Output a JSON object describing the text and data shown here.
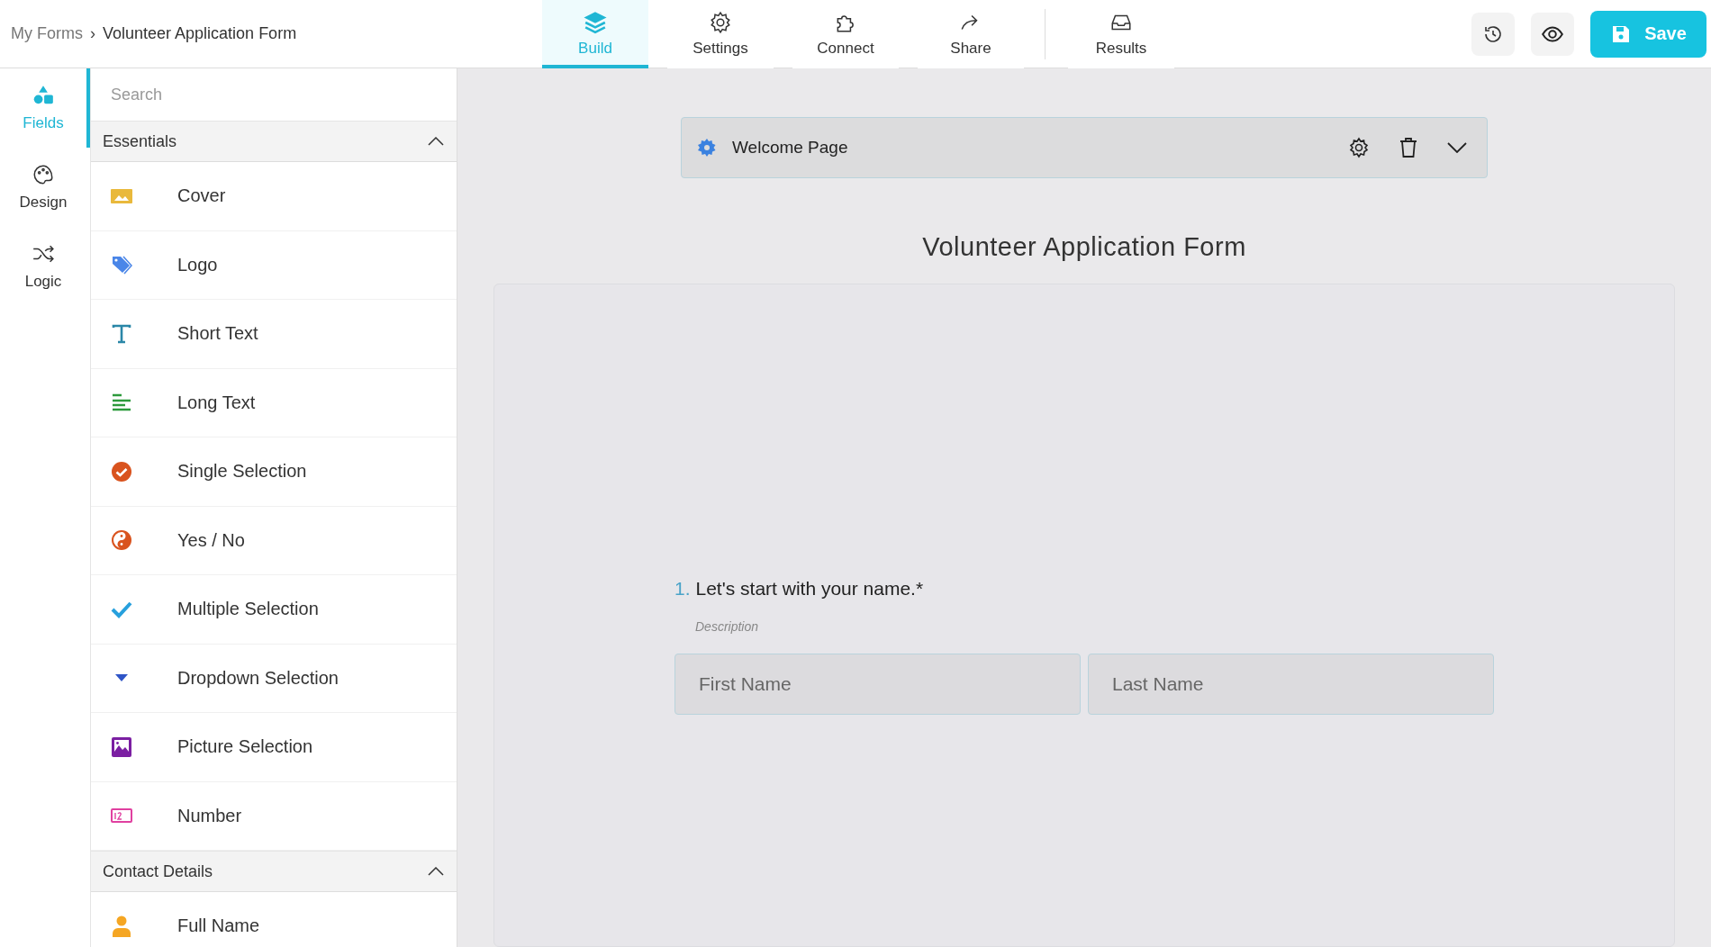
{
  "breadcrumb": {
    "parent": "My Forms",
    "separator": "›",
    "current": "Volunteer Application Form"
  },
  "tabs": [
    {
      "label": "Build",
      "kind": "build",
      "selected": true
    },
    {
      "label": "Settings",
      "kind": "settings",
      "selected": false
    },
    {
      "label": "Connect",
      "kind": "connect",
      "selected": false
    },
    {
      "label": "Share",
      "kind": "share",
      "selected": false
    },
    {
      "label": "Results",
      "kind": "results",
      "selected": false
    }
  ],
  "save_button": {
    "label": "Save"
  },
  "rail": [
    {
      "label": "Fields",
      "kind": "fields",
      "selected": true
    },
    {
      "label": "Design",
      "kind": "design",
      "selected": false
    },
    {
      "label": "Logic",
      "kind": "logic",
      "selected": false
    }
  ],
  "search": {
    "placeholder": "Search"
  },
  "sections": [
    {
      "title": "Essentials",
      "expanded": true,
      "items": [
        {
          "label": "Cover",
          "kind": "cover"
        },
        {
          "label": "Logo",
          "kind": "logo"
        },
        {
          "label": "Short Text",
          "kind": "short"
        },
        {
          "label": "Long Text",
          "kind": "long"
        },
        {
          "label": "Single Selection",
          "kind": "single"
        },
        {
          "label": "Yes / No",
          "kind": "yesno"
        },
        {
          "label": "Multiple Selection",
          "kind": "multiple"
        },
        {
          "label": "Dropdown Selection",
          "kind": "dropdown"
        },
        {
          "label": "Picture Selection",
          "kind": "picture"
        },
        {
          "label": "Number",
          "kind": "number"
        }
      ]
    },
    {
      "title": "Contact Details",
      "expanded": true,
      "items": [
        {
          "label": "Full Name",
          "kind": "person"
        }
      ]
    }
  ],
  "page_bar": {
    "title": "Welcome Page"
  },
  "form": {
    "title": "Volunteer Application Form",
    "question": {
      "number": "1.",
      "text": "Let's start with your name.*",
      "description": "Description",
      "fields": [
        {
          "placeholder": "First Name"
        },
        {
          "placeholder": "Last Name"
        }
      ]
    }
  }
}
